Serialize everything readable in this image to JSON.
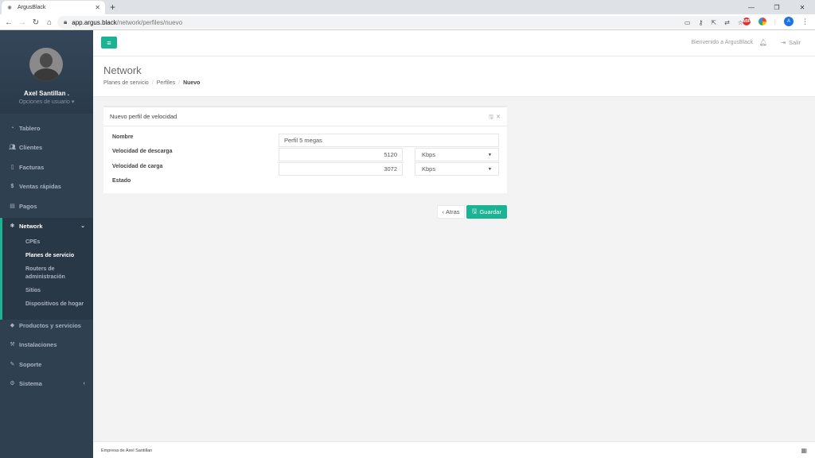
{
  "browser": {
    "tab_title": "ArgusBlack",
    "url_host": "app.argus.black",
    "url_path": "/network/perfiles/nuevo",
    "profile_initial": "A"
  },
  "user": {
    "name": "Axel Santillan .",
    "options_label": "Opciones de usuario"
  },
  "sidebar": {
    "items": [
      {
        "label": "Tablero",
        "icon": "dashboard-icon"
      },
      {
        "label": "Clientes",
        "icon": "users-icon"
      },
      {
        "label": "Facturas",
        "icon": "file-icon"
      },
      {
        "label": "Ventas rápidas",
        "icon": "dollar-icon"
      },
      {
        "label": "Pagos",
        "icon": "money-icon"
      },
      {
        "label": "Network",
        "icon": "snowflake-icon"
      },
      {
        "label": "Productos y servicios",
        "icon": "tag-icon"
      },
      {
        "label": "Instalaciones",
        "icon": "wrench-icon"
      },
      {
        "label": "Soporte",
        "icon": "tools-icon"
      },
      {
        "label": "Sistema",
        "icon": "cogs-icon"
      }
    ],
    "network_sub": [
      {
        "label": "CPEs"
      },
      {
        "label": "Planes de servicio"
      },
      {
        "label": "Routers de administración"
      },
      {
        "label": "Sitios"
      },
      {
        "label": "Dispositivos de hogar"
      }
    ]
  },
  "topnav": {
    "welcome": "Bienvenido a ArgusBlack",
    "logout": "Salir"
  },
  "page": {
    "title": "Network",
    "breadcrumb": [
      "Planes de servicio",
      "Perfiles",
      "Nuevo"
    ]
  },
  "form": {
    "title": "Nuevo perfil de velocidad",
    "name_label": "Nombre",
    "name_value": "Perfil 5 megas",
    "download_label": "Velocidad de descarga",
    "download_value": "5120",
    "download_unit": "Kbps",
    "upload_label": "Velocidad de carga",
    "upload_value": "3072",
    "upload_unit": "Kbps",
    "status_label": "Estado"
  },
  "buttons": {
    "back": "Atras",
    "save": "Guardar"
  },
  "footer": {
    "text": "Empresa de Axel Santillan"
  },
  "colors": {
    "accent": "#1ab394",
    "sidebar": "#2f4050"
  }
}
